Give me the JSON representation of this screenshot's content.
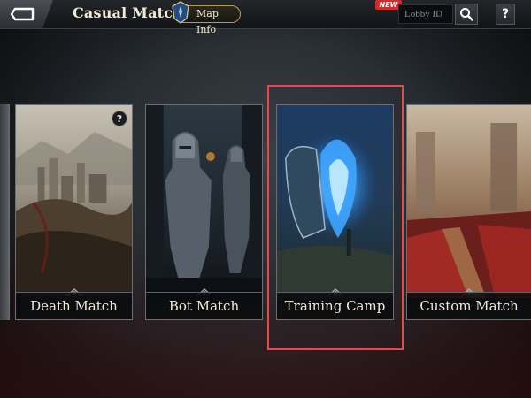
{
  "header": {
    "title": "Casual Match",
    "map_info_label": "Map Info",
    "new_badge": "NEW",
    "lobby_placeholder": "Lobby ID",
    "help_label": "?"
  },
  "modes": [
    {
      "label": "Death Match",
      "help": "?"
    },
    {
      "label": "Bot Match"
    },
    {
      "label": "Training Camp",
      "selected": true
    },
    {
      "label": "Custom Match"
    }
  ],
  "colors": {
    "highlight": "#e8474c",
    "title": "#f1e9d2",
    "new_badge": "#d52a2a"
  }
}
